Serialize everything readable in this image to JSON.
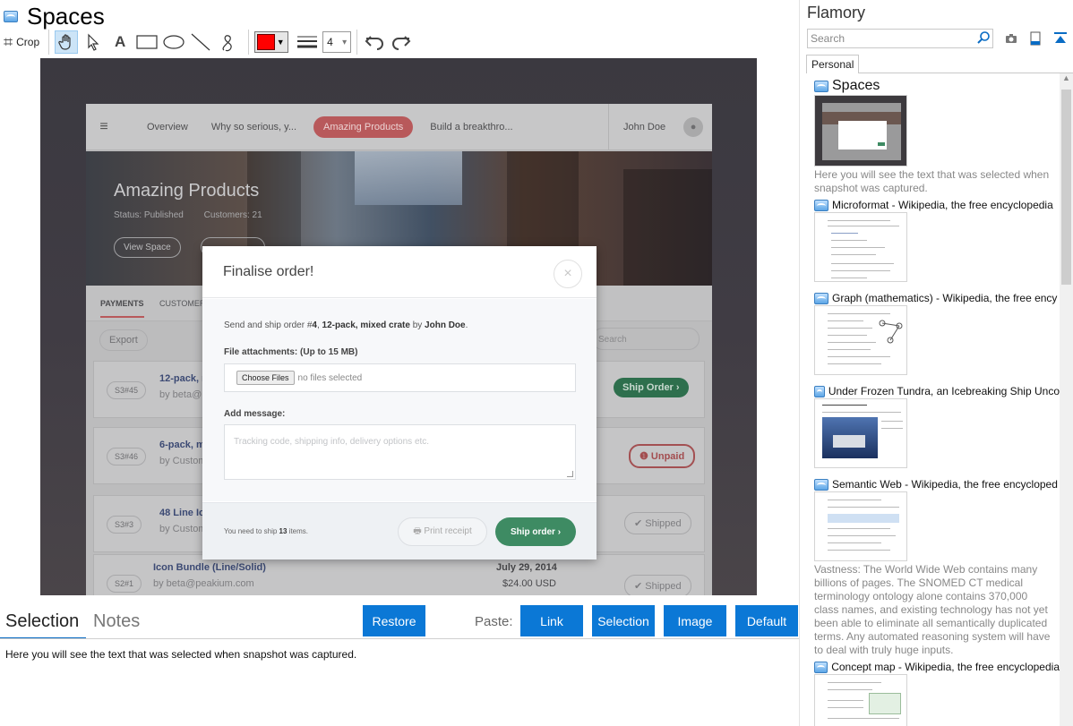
{
  "app": {
    "title": "Spaces",
    "toolbar": {
      "crop_label": "Crop",
      "text_tool": "A",
      "line_width": "4",
      "line_width_dropdown": "▾",
      "color": "#ff0000"
    }
  },
  "snapshot": {
    "nav": {
      "menu_icon": "≡",
      "tabs": [
        "Overview",
        "Why so serious, y...",
        "Amazing Products",
        "Build a breakthro..."
      ],
      "active_tab": "Amazing Products",
      "user": "John Doe",
      "avatar": "●"
    },
    "hero": {
      "title": "Amazing Products",
      "status": "Status: Published",
      "customers": "Customers: 21",
      "view_space": "View Space"
    },
    "subtabs": {
      "payments": "PAYMENTS",
      "customers": "CUSTOMER"
    },
    "export": "Export",
    "search_placeholder": "Search",
    "rows": [
      {
        "code": "S3#45",
        "title": "12-pack, m",
        "sub": "by beta@",
        "date": "",
        "price": "",
        "status": "Ship Order ›",
        "kind": "ship"
      },
      {
        "code": "S3#46",
        "title": "6-pack, m",
        "sub": "by Custom",
        "date": "",
        "price": "",
        "status": "❶ Unpaid",
        "kind": "unpaid"
      },
      {
        "code": "S3#3",
        "title": "48 Line Ico",
        "sub": "by Custome",
        "date": "",
        "price": "",
        "status": "✔ Shipped",
        "kind": "shipped"
      },
      {
        "code": "S2#1",
        "title": "Icon Bundle (Line/Solid)",
        "sub": "by beta@peakium.com",
        "date": "July 29, 2014",
        "price": "$24.00 USD",
        "status": "✔ Shipped",
        "kind": "shipped"
      }
    ],
    "modal": {
      "title": "Finalise order!",
      "close": "×",
      "desc_prefix": "Send and ship order #",
      "order_no": "4",
      "desc_sep": ", ",
      "product": "12-pack, mixed crate",
      "desc_by": " by ",
      "customer": "John Doe",
      "desc_end": ".",
      "attach_label": "File attachments: (Up to 15 MB)",
      "choose_files": "Choose Files",
      "no_files": "no files selected",
      "message_label": "Add message:",
      "message_placeholder": "Tracking code, shipping info, delivery options etc.",
      "ship_prefix": "You need to ship ",
      "ship_count": "13",
      "ship_suffix": " items.",
      "print_receipt": "🖶  Print receipt",
      "ship_order": "Ship order  ›"
    }
  },
  "bottom": {
    "tab_selection": "Selection",
    "tab_notes": "Notes",
    "restore": "Restore",
    "paste_label": "Paste:",
    "paste_link": "Link",
    "paste_selection": "Selection",
    "paste_image": "Image",
    "paste_default": "Default",
    "selection_text": "Here you will see the text that was selected when snapshot was captured."
  },
  "flamory": {
    "title": "Flamory",
    "search_placeholder": "Search",
    "tab": "Personal",
    "snapshots": [
      {
        "title": "Spaces",
        "desc": "Here you will see the text that was selected when snapshot was captured."
      },
      {
        "title": "Microformat - Wikipedia, the free encyclopedia",
        "desc": ""
      },
      {
        "title": "Graph (mathematics) - Wikipedia, the free ency",
        "desc": ""
      },
      {
        "title": "Under Frozen Tundra, an Icebreaking Ship Unco",
        "desc": ""
      },
      {
        "title": "Semantic Web - Wikipedia, the free encycloped",
        "desc": "Vastness: The World Wide Web contains many billions of pages. The SNOMED CT medical terminology ontology alone contains 370,000 class names, and existing technology has not yet been able to eliminate all semantically duplicated terms. Any automated reasoning system will have to deal with truly huge inputs."
      },
      {
        "title": "Concept map - Wikipedia, the free encyclopedia",
        "desc": ""
      }
    ]
  }
}
